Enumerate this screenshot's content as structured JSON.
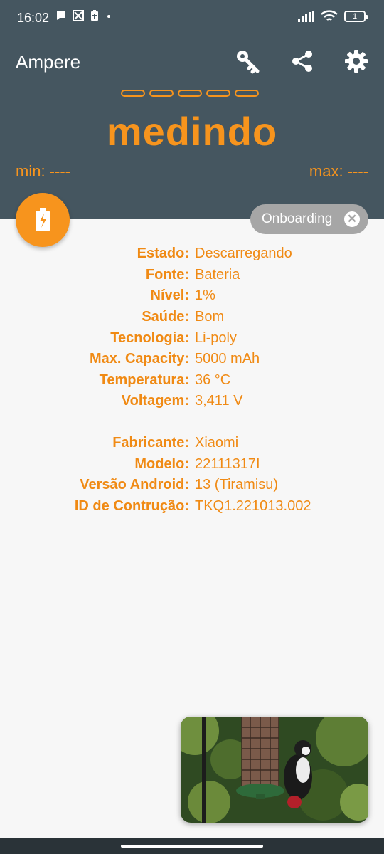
{
  "status_bar": {
    "time": "16:02",
    "battery": "1"
  },
  "app": {
    "title": "Ampere",
    "actions": [
      "key-icon",
      "share-icon",
      "settings-icon"
    ],
    "status": "medindo",
    "min": "min: ----",
    "max": "max: ----"
  },
  "chip": {
    "label": "Onboarding"
  },
  "battery_info": [
    {
      "label": "Estado:",
      "value": "Descarregando"
    },
    {
      "label": "Fonte:",
      "value": "Bateria"
    },
    {
      "label": "Nível:",
      "value": "1%"
    },
    {
      "label": "Saúde:",
      "value": "Bom"
    },
    {
      "label": "Tecnologia:",
      "value": "Li-poly"
    },
    {
      "label": "Max. Capacity:",
      "value": "5000 mAh"
    },
    {
      "label": "Temperatura:",
      "value": "36 °C"
    },
    {
      "label": "Voltagem:",
      "value": "3,411 V"
    }
  ],
  "device_info": [
    {
      "label": "Fabricante:",
      "value": "Xiaomi"
    },
    {
      "label": "Modelo:",
      "value": "22111317I"
    },
    {
      "label": "Versão Android:",
      "value": "13 (Tiramisu)"
    },
    {
      "label": "ID de Contrução:",
      "value": "TKQ1.221013.002"
    }
  ],
  "colors": {
    "header": "#455660",
    "accent": "#f7941d",
    "background": "#f7f7f7"
  }
}
